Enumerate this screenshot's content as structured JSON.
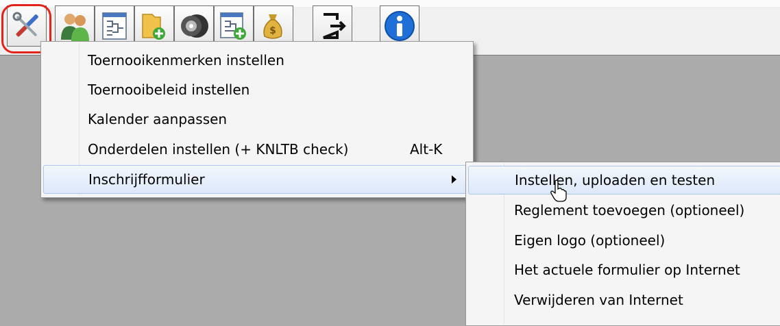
{
  "toolbar": {
    "buttons": [
      {
        "icon": "tools-icon",
        "selected": true
      },
      {
        "icon": "players-icon"
      },
      {
        "icon": "draw-schedule-icon"
      },
      {
        "icon": "folder-add-icon"
      },
      {
        "icon": "tennis-balls-icon"
      },
      {
        "icon": "schedule-add-icon"
      },
      {
        "icon": "money-bag-icon"
      },
      {
        "icon": "exit-icon"
      },
      {
        "icon": "info-icon"
      }
    ],
    "highlight_color": "#e2231a"
  },
  "main_menu": {
    "items": [
      {
        "label": "Toernooikenmerken instellen"
      },
      {
        "label": "Toernooibeleid instellen"
      },
      {
        "label": "Kalender aanpassen"
      },
      {
        "label": "Onderdelen instellen (+ KNLTB check)",
        "shortcut": "Alt-K"
      },
      {
        "label": "Inschrijfformulier",
        "has_submenu": true,
        "active": true
      }
    ]
  },
  "sub_menu": {
    "items": [
      {
        "label": "Instellen, uploaden en testen",
        "active": true
      },
      {
        "label": "Reglement toevoegen (optioneel)"
      },
      {
        "label": "Eigen logo (optioneel)"
      },
      {
        "label": "Het actuele formulier op Internet"
      },
      {
        "label": "Verwijderen van Internet"
      }
    ]
  },
  "colors": {
    "workspace": "#ababab",
    "menu_background": "#f5f5f5",
    "active_item_border": "#a8c6ee"
  }
}
